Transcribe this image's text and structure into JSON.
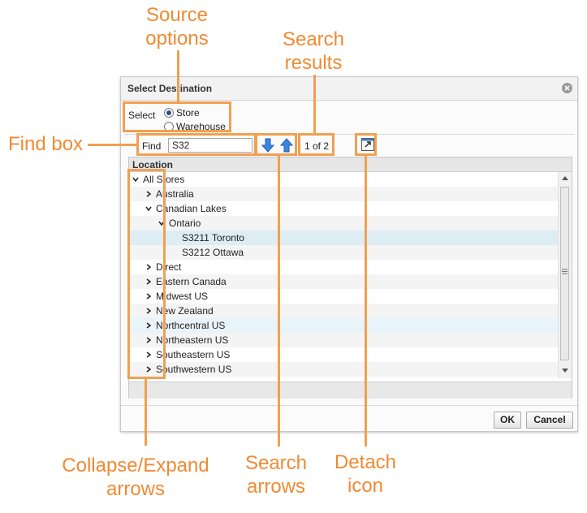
{
  "dialog": {
    "title": "Select Destination",
    "source": {
      "label": "Select",
      "options": [
        "Store",
        "Warehouse"
      ],
      "selected": "Store"
    },
    "find": {
      "label": "Find",
      "value": "S32"
    },
    "search_results": "1 of 2",
    "tree": {
      "header": "Location",
      "rows": [
        {
          "label": "All Stores",
          "expanded": true
        },
        {
          "label": "Australia",
          "expanded": false
        },
        {
          "label": "Canadian Lakes",
          "expanded": true
        },
        {
          "label": "Ontario",
          "expanded": true
        },
        {
          "label": "S3211 Toronto"
        },
        {
          "label": "S3212 Ottawa"
        },
        {
          "label": "Direct",
          "expanded": false
        },
        {
          "label": "Eastern Canada",
          "expanded": false
        },
        {
          "label": "Midwest US",
          "expanded": false
        },
        {
          "label": "New Zealand",
          "expanded": false
        },
        {
          "label": "Northcentral US",
          "expanded": false
        },
        {
          "label": "Northeastern US",
          "expanded": false
        },
        {
          "label": "Southeastern US",
          "expanded": false
        },
        {
          "label": "Southwestern US",
          "expanded": false
        }
      ]
    },
    "ok_label": "OK",
    "cancel_label": "Cancel"
  },
  "callouts": {
    "source_options": [
      "Source",
      "options"
    ],
    "search_results": [
      "Search",
      "results"
    ],
    "find_box": "Find box",
    "collapse_expand": [
      "Collapse/Expand",
      "arrows"
    ],
    "search_arrows": [
      "Search",
      "arrows"
    ],
    "detach_icon": [
      "Detach",
      "icon"
    ]
  },
  "colors": {
    "callout": "#f08a32",
    "highlight_row": "#ddedf3",
    "arrow_blue": "#2f7fd6"
  }
}
